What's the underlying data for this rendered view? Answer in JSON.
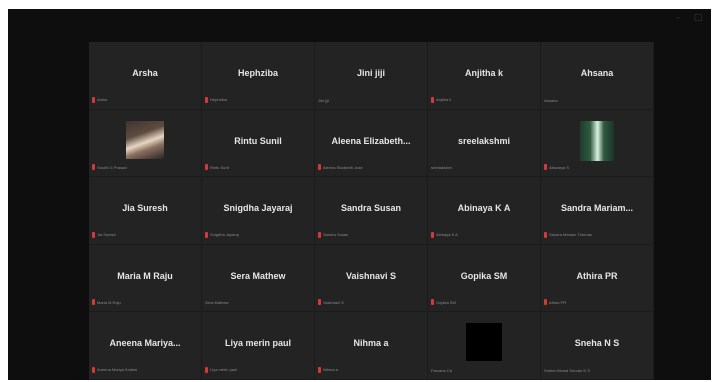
{
  "window": {
    "minimize_glyph": "–",
    "maximize_glyph": "□"
  },
  "participants": [
    {
      "name": "Arsha",
      "small_name": "Arsha",
      "muted": true,
      "video": null
    },
    {
      "name": "Hephziba",
      "small_name": "Hephziba",
      "muted": true,
      "video": null
    },
    {
      "name": "Jini jiji",
      "small_name": "Jini jiji",
      "muted": false,
      "video": null
    },
    {
      "name": "Anjitha k",
      "small_name": "Anjitha k",
      "muted": true,
      "video": null
    },
    {
      "name": "Ahsana",
      "small_name": "Ahsana",
      "muted": false,
      "video": null
    },
    {
      "name": "",
      "small_name": "Srudhi G Prasad",
      "muted": true,
      "video": "shoe"
    },
    {
      "name": "Rintu Sunil",
      "small_name": "Rintu Sunil",
      "muted": true,
      "video": null
    },
    {
      "name": "Aleena Elizabeth...",
      "small_name": "Aleena Elizabeth Jose",
      "muted": true,
      "video": null
    },
    {
      "name": "sreelakshmi",
      "small_name": "sreelakshmi",
      "muted": false,
      "video": null
    },
    {
      "name": "",
      "small_name": "Aiswarya S",
      "muted": true,
      "video": "forest"
    },
    {
      "name": "Jia Suresh",
      "small_name": "Jia Suresh",
      "muted": true,
      "video": null
    },
    {
      "name": "Snigdha Jayaraj",
      "small_name": "Snigdha Jayaraj",
      "muted": true,
      "video": null
    },
    {
      "name": "Sandra Susan",
      "small_name": "Sandra Susan",
      "muted": true,
      "video": null
    },
    {
      "name": "Abinaya K A",
      "small_name": "Abinaya K A",
      "muted": true,
      "video": null
    },
    {
      "name": "Sandra Mariam...",
      "small_name": "Sandra Mariam Thomas",
      "muted": true,
      "video": null
    },
    {
      "name": "Maria M Raju",
      "small_name": "Maria M Raju",
      "muted": true,
      "video": null
    },
    {
      "name": "Sera Mathew",
      "small_name": "Sera Mathew",
      "muted": false,
      "video": null
    },
    {
      "name": "Vaishnavi S",
      "small_name": "Vaishnavi S",
      "muted": true,
      "video": null
    },
    {
      "name": "Gopika SM",
      "small_name": "Gopika SM",
      "muted": true,
      "video": null
    },
    {
      "name": "Athira PR",
      "small_name": "Athira PR",
      "muted": true,
      "video": null
    },
    {
      "name": "Aneena Mariya...",
      "small_name": "Aneena Mariya Kollam",
      "muted": true,
      "video": null
    },
    {
      "name": "Liya merin paul",
      "small_name": "Liya merin paul",
      "muted": true,
      "video": null
    },
    {
      "name": "Nihma a",
      "small_name": "Nihma a",
      "muted": true,
      "video": null
    },
    {
      "name": "",
      "small_name": "Farzana CA",
      "muted": false,
      "video": "black"
    },
    {
      "name": "Sneha N S",
      "small_name": "Sneha Nirmal Sundar N S",
      "muted": false,
      "video": null
    }
  ],
  "colors": {
    "window_bg": "#0e0e0e",
    "tile_bg": "#232323",
    "muted_red": "#d23a3a"
  }
}
